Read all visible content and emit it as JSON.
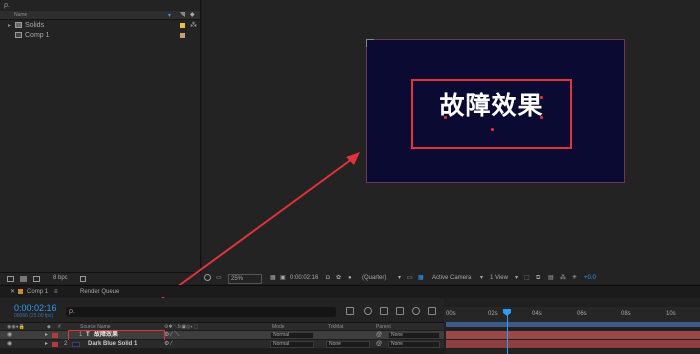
{
  "project": {
    "search": "ρ.",
    "header": {
      "name_col": "Name"
    },
    "items": [
      {
        "label": "Solids",
        "type": "folder",
        "tag_color": "#e8c33a"
      },
      {
        "label": "Comp 1",
        "type": "composition",
        "tag_color": "#c8a070"
      }
    ],
    "footer_bpc": "8 bpc"
  },
  "viewer": {
    "comp_text": "故障效果",
    "zoom": "25%",
    "timecode": "0:00:02:16",
    "resolution": "(Quarter)",
    "camera": "Active Camera",
    "views": "1 View",
    "exposure": "+0.0"
  },
  "timeline": {
    "tab_label": "Comp 1",
    "render_queue": "Render Queue",
    "timecode": "0:00:02:16",
    "frame_info": "00066 (25.00 fps)",
    "search_placeholder": "ρ.",
    "columns": {
      "source": "Source Name",
      "mode": "Mode",
      "trkmat": "TrkMat",
      "parent": "Parent"
    },
    "layers": [
      {
        "num": "1",
        "name": "故障效果",
        "type": "text",
        "mode": "Normal",
        "trkmat": "",
        "parent": "None",
        "label_color": "#b33b3b"
      },
      {
        "num": "2",
        "name": "Dark Blue Solid 1",
        "type": "solid",
        "mode": "Normal",
        "trkmat": "None",
        "parent": "None",
        "label_color": "#b33b3b"
      }
    ],
    "ruler_ticks": [
      "00s",
      "02s",
      "04s",
      "06s",
      "08s",
      "10s"
    ],
    "colors": {
      "accent": "#2c9dfa",
      "highlight": "#e0333a",
      "comp_bg": "#0b0a33",
      "layer_bar": "#9a4848"
    }
  }
}
